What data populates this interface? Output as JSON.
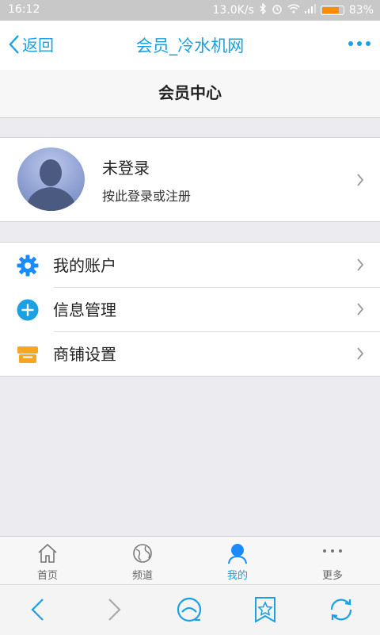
{
  "status_bar": {
    "time": "16:12",
    "network_speed": "13.0K/s",
    "battery_percent": "83%",
    "battery_level": 0.83,
    "icons": [
      "bluetooth-icon",
      "alarm-icon",
      "wifi-icon",
      "signal-icon",
      "battery-icon"
    ]
  },
  "nav": {
    "back_label": "返回",
    "title": "会员_冷水机网",
    "more_icon": "more-dots-icon"
  },
  "subheader": {
    "title": "会员中心"
  },
  "profile": {
    "name": "未登录",
    "hint": "按此登录或注册",
    "avatar_icon": "default-avatar-icon"
  },
  "menu": {
    "items": [
      {
        "label": "我的账户",
        "icon": "gear-icon",
        "color": "#1a8cff"
      },
      {
        "label": "信息管理",
        "icon": "plus-circle-icon",
        "color": "#1ba1e2"
      },
      {
        "label": "商铺设置",
        "icon": "shop-icon",
        "color": "#f5a623"
      }
    ]
  },
  "tabs": {
    "items": [
      {
        "label": "首页",
        "icon": "home-icon",
        "active": false
      },
      {
        "label": "频道",
        "icon": "globe-icon",
        "active": false
      },
      {
        "label": "我的",
        "icon": "user-icon",
        "active": true
      },
      {
        "label": "更多",
        "icon": "more-dots-icon",
        "active": false
      }
    ]
  },
  "browser_toolbar": {
    "icons": [
      "back-arrow-icon",
      "forward-arrow-icon",
      "browser-home-icon",
      "bookmark-star-icon",
      "refresh-icon"
    ]
  },
  "colors": {
    "accent": "#1ba1e2",
    "active_tab": "#1ba1e2",
    "battery": "#ff8c00"
  }
}
